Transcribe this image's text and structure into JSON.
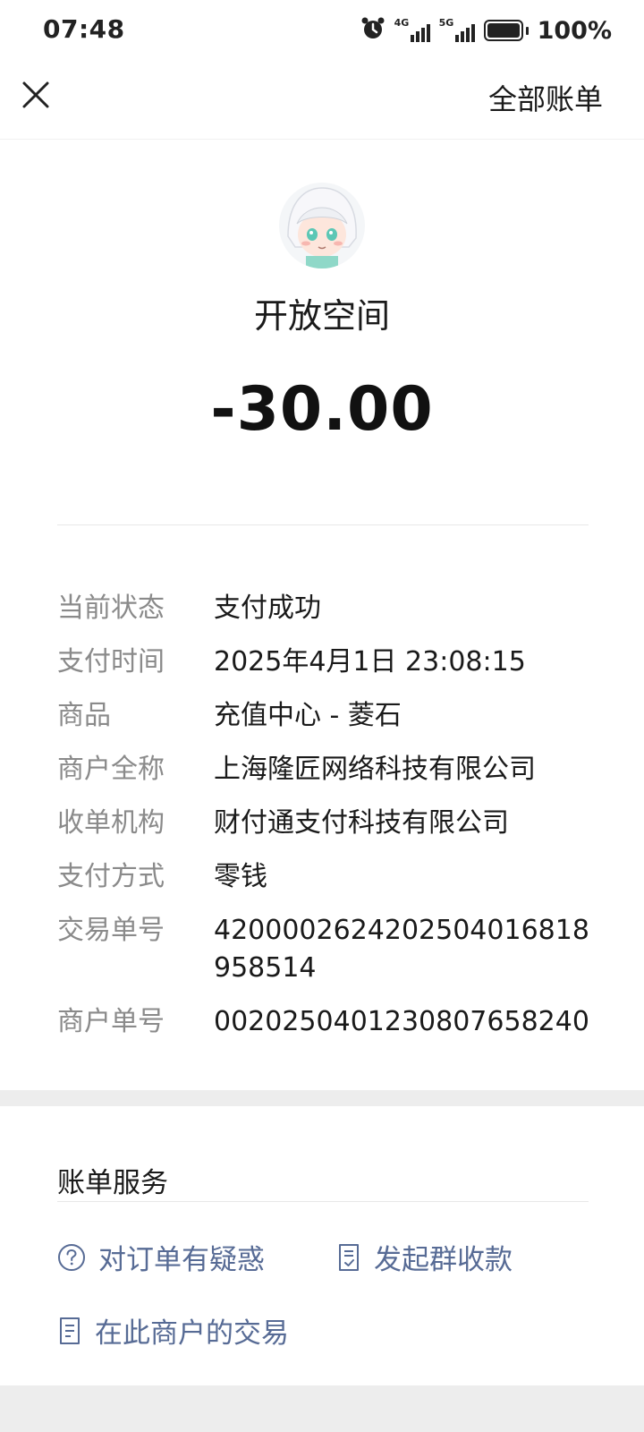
{
  "status_bar": {
    "time": "07:48",
    "network1": "4G",
    "network2": "5G",
    "battery": "100%"
  },
  "header": {
    "close_icon": "close-icon",
    "all_bills_label": "全部账单"
  },
  "merchant": {
    "avatar_icon": "avatar-icon",
    "name": "开放空间",
    "amount": "-30.00"
  },
  "details": [
    {
      "label": "当前状态",
      "value": "支付成功"
    },
    {
      "label": "支付时间",
      "value": "2025年4月1日 23:08:15"
    },
    {
      "label": "商品",
      "value": "充值中心 - 菱石"
    },
    {
      "label": "商户全称",
      "value": "上海隆匠网络科技有限公司"
    },
    {
      "label": "收单机构",
      "value": "财付通支付科技有限公司"
    },
    {
      "label": "支付方式",
      "value": "零钱"
    },
    {
      "label": "交易单号",
      "value": "4200002624202504016818958514"
    },
    {
      "label": "商户单号",
      "value": "0020250401230807658240"
    }
  ],
  "services": {
    "title": "账单服务",
    "items": [
      {
        "label": "对订单有疑惑",
        "icon": "question-circle-icon"
      },
      {
        "label": "发起群收款",
        "icon": "document-check-icon"
      },
      {
        "label": "在此商户的交易",
        "icon": "document-list-icon"
      }
    ]
  },
  "colors": {
    "link": "#576b95",
    "label_gray": "#8a8a8a",
    "section_gray": "#ededed"
  }
}
